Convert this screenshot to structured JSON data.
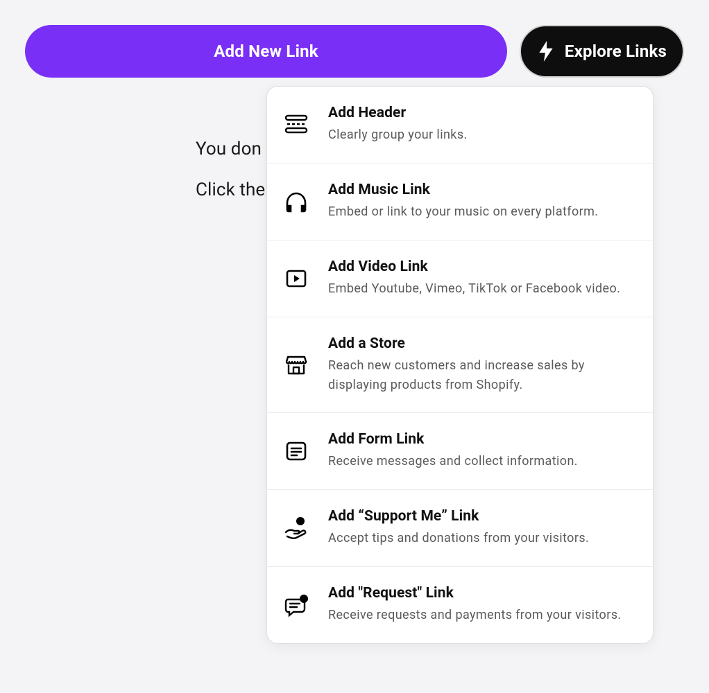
{
  "buttons": {
    "add_new_link": "Add New Link",
    "explore_links": "Explore Links"
  },
  "background_text": {
    "line1": "You don",
    "line2": "Click the"
  },
  "menu": [
    {
      "icon": "header-icon",
      "title": "Add Header",
      "desc": "Clearly group your links."
    },
    {
      "icon": "music-icon",
      "title": "Add Music Link",
      "desc": "Embed or link to your music on every platform."
    },
    {
      "icon": "video-icon",
      "title": "Add Video Link",
      "desc": "Embed Youtube, Vimeo, TikTok or Facebook video."
    },
    {
      "icon": "store-icon",
      "title": "Add a Store",
      "desc": "Reach new customers and increase sales by displaying products from Shopify."
    },
    {
      "icon": "form-icon",
      "title": "Add Form Link",
      "desc": "Receive messages and collect information."
    },
    {
      "icon": "support-icon",
      "title": "Add “Support Me” Link",
      "desc": "Accept tips and donations from your visitors."
    },
    {
      "icon": "request-icon",
      "title": "Add \"Request\" Link",
      "desc": "Receive requests and payments from your visitors."
    }
  ]
}
